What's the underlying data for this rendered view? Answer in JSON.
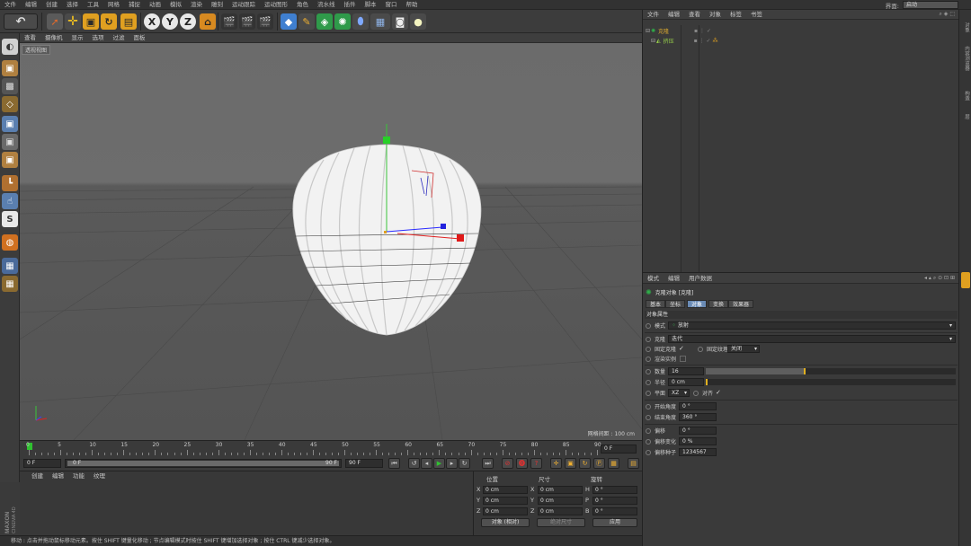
{
  "menubar": {
    "items": [
      "文件",
      "编辑",
      "创建",
      "选择",
      "工具",
      "网格",
      "捕捉",
      "动画",
      "模拟",
      "渲染",
      "雕刻",
      "运动跟踪",
      "运动图形",
      "角色",
      "流水线",
      "插件",
      "脚本",
      "窗口",
      "帮助"
    ],
    "layout_label": "界面:",
    "layout_value": "启动"
  },
  "toolbar": {
    "icons": [
      "undo-icon",
      "select-icon",
      "move-icon",
      "scale-icon",
      "rotate-icon",
      "recent-tool-icon",
      "x-axis-icon",
      "y-axis-icon",
      "z-axis-icon",
      "coordinate-system-icon",
      "render-view-icon",
      "render-picture-queue-icon",
      "edit-render-settings-icon",
      "cube-icon",
      "pen-icon",
      "subdivision-icon",
      "cloner-icon",
      "deformer-icon",
      "floor-icon",
      "camera-icon",
      "light-icon"
    ],
    "axis_x": "X",
    "axis_y": "Y",
    "axis_z": "Z"
  },
  "viewport": {
    "menu": [
      "查看",
      "摄像机",
      "显示",
      "选项",
      "过滤",
      "面板"
    ],
    "view_label": "透视视图",
    "grid_distance": "网格间距 : 100 cm"
  },
  "timeline": {
    "ticks": [
      "0",
      "5",
      "10",
      "15",
      "20",
      "25",
      "30",
      "35",
      "40",
      "45",
      "50",
      "55",
      "60",
      "65",
      "70",
      "75",
      "80",
      "85",
      "90"
    ],
    "current_frame": "0 F"
  },
  "time_controls": {
    "start": "0 F",
    "range_start": "0 F",
    "range_end": "90 F",
    "end": "90 F"
  },
  "material_manager": {
    "menu": [
      "创建",
      "编辑",
      "功能",
      "纹理"
    ],
    "logo_line1": "MAXON",
    "logo_line2": "CINEMA 4D"
  },
  "coordinates": {
    "headers": [
      "位置",
      "尺寸",
      "旋转"
    ],
    "rows": [
      {
        "axis": "X",
        "pos": "0 cm",
        "size_axis": "X",
        "size": "0 cm",
        "rot_axis": "H",
        "rot": "0 °"
      },
      {
        "axis": "Y",
        "pos": "0 cm",
        "size_axis": "Y",
        "size": "0 cm",
        "rot_axis": "P",
        "rot": "0 °"
      },
      {
        "axis": "Z",
        "pos": "0 cm",
        "size_axis": "Z",
        "size": "0 cm",
        "rot_axis": "B",
        "rot": "0 °"
      }
    ],
    "mode": "对象 (相对)",
    "size_mode": "绝对尺寸",
    "apply": "应用"
  },
  "statusbar": {
    "text": "移动 : 点击并拖动鼠标移动元素。按住 SHIFT 键量化移动 ; 节点编辑模式时按住 SHIFT 键增加选择对象 ; 按住 CTRL 键减少选择对象。"
  },
  "object_manager": {
    "menu": [
      "文件",
      "编辑",
      "查看",
      "对象",
      "标签",
      "书签"
    ],
    "objects": [
      {
        "name": "克隆",
        "color": "#d9a830"
      },
      {
        "name": "挤压",
        "color": "#9ad34a"
      }
    ]
  },
  "side_tabs": [
    "对象",
    "内容浏览器",
    "构造",
    "层"
  ],
  "attributes": {
    "menu": [
      "模式",
      "编辑",
      "用户数据"
    ],
    "object_title": "克隆对象 [克隆]",
    "tabs": [
      "基本",
      "坐标",
      "对象",
      "变换",
      "效果器"
    ],
    "active_tab": "对象",
    "section_title": "对象属性",
    "mode_label": "模式",
    "mode_value": "放射",
    "clones_label": "克隆",
    "clones_value": "迭代",
    "fix_clone_label": "固定克隆",
    "fix_texture_label": "固定纹理",
    "fix_texture_value": "关闭",
    "render_instances_label": "渲染实例",
    "count_label": "数量",
    "count_value": "16",
    "count_fill": 0.4,
    "radius_label": "半径",
    "radius_value": "0 cm",
    "plane_label": "平面",
    "plane_value": "XZ",
    "align_label": "对齐",
    "start_angle_label": "开始角度",
    "start_angle_value": "0 °",
    "end_angle_label": "结束角度",
    "end_angle_value": "360 °",
    "offset_label": "偏移",
    "offset_value": "0 °",
    "offset_var_label": "偏移变化",
    "offset_var_value": "0 %",
    "offset_seed_label": "偏移种子",
    "offset_seed_value": "1234567"
  }
}
